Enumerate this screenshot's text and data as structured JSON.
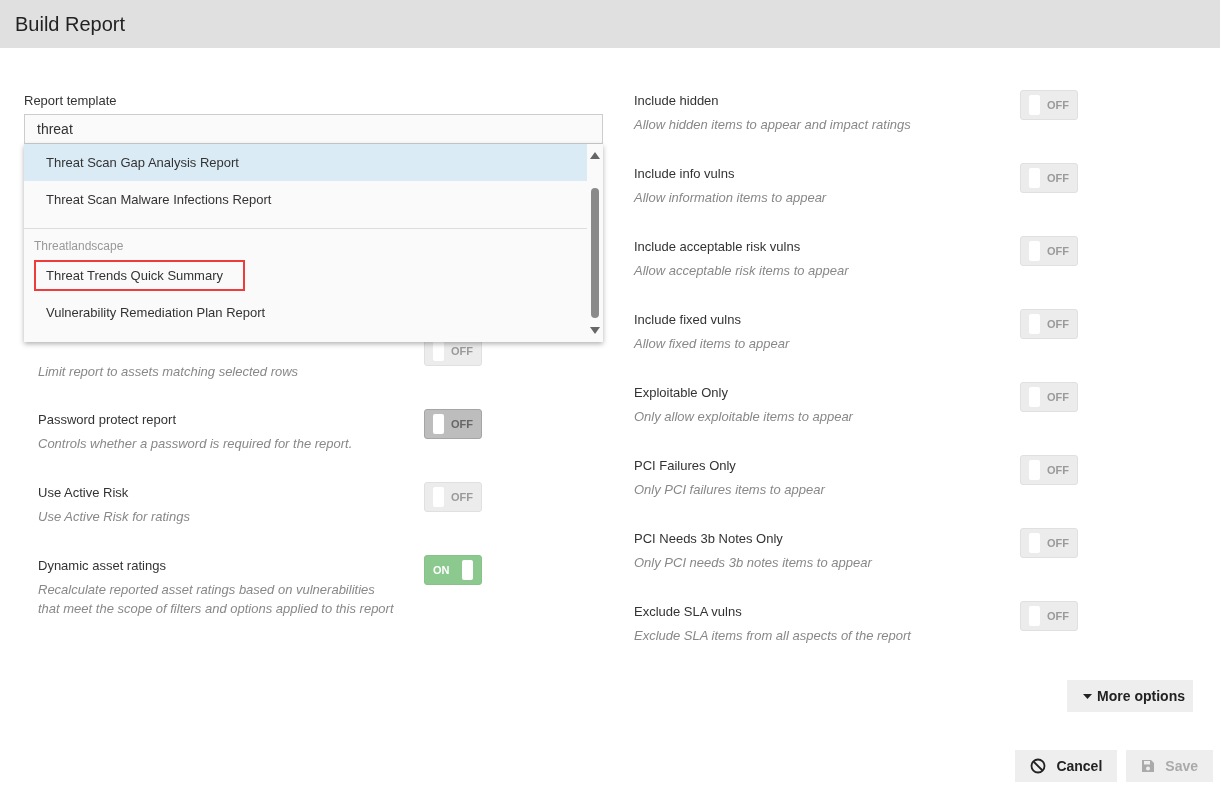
{
  "window": {
    "title": "Build Report"
  },
  "report_template": {
    "label": "Report template",
    "value": "threat",
    "dropdown": [
      {
        "kind": "option",
        "label": "Threat Scan Gap Analysis Report",
        "selected": true,
        "outlined": false
      },
      {
        "kind": "option",
        "label": "Threat Scan Malware Infections Report",
        "selected": false,
        "outlined": false
      },
      {
        "kind": "group",
        "label": "Threatlandscape"
      },
      {
        "kind": "option",
        "label": "Threat Trends Quick Summary",
        "selected": false,
        "outlined": true
      },
      {
        "kind": "option",
        "label": "Vulnerability Remediation Plan Report",
        "selected": false,
        "outlined": false
      }
    ]
  },
  "left_options": [
    {
      "description": "Limit report to assets matching selected rows",
      "on": false,
      "disabled": true,
      "state_text": "OFF"
    },
    {
      "label": "Password protect report",
      "description": "Controls whether a password is required for the report.",
      "on": false,
      "disabled": false,
      "state_text": "OFF"
    },
    {
      "label": "Use Active Risk",
      "description": "Use Active Risk for ratings",
      "on": false,
      "disabled": true,
      "state_text": "OFF"
    },
    {
      "label": "Dynamic asset ratings",
      "description": "Recalculate reported asset ratings based on vulnerabilities that meet the scope of filters and options applied to this report",
      "on": true,
      "disabled": true,
      "state_text": "ON"
    }
  ],
  "right_options": [
    {
      "label": "Include hidden",
      "description": "Allow hidden items to appear and impact ratings",
      "on": false,
      "disabled": true,
      "state_text": "OFF"
    },
    {
      "label": "Include info vulns",
      "description": "Allow information items to appear",
      "on": false,
      "disabled": true,
      "state_text": "OFF"
    },
    {
      "label": "Include acceptable risk vulns",
      "description": "Allow acceptable risk items to appear",
      "on": false,
      "disabled": true,
      "state_text": "OFF"
    },
    {
      "label": "Include fixed vulns",
      "description": "Allow fixed items to appear",
      "on": false,
      "disabled": true,
      "state_text": "OFF"
    },
    {
      "label": "Exploitable Only",
      "description": "Only allow exploitable items to appear",
      "on": false,
      "disabled": true,
      "state_text": "OFF"
    },
    {
      "label": "PCI Failures Only",
      "description": "Only PCI failures items to appear",
      "on": false,
      "disabled": true,
      "state_text": "OFF"
    },
    {
      "label": "PCI Needs 3b Notes Only",
      "description": "Only PCI needs 3b notes items to appear",
      "on": false,
      "disabled": true,
      "state_text": "OFF"
    },
    {
      "label": "Exclude SLA vulns",
      "description": "Exclude SLA items from all aspects of the report",
      "on": false,
      "disabled": true,
      "state_text": "OFF"
    }
  ],
  "more_options": {
    "label": "More options"
  },
  "buttons": [
    {
      "kind": "cancel",
      "label": "Cancel",
      "disabled": false
    },
    {
      "kind": "save",
      "label": "Save",
      "disabled": true
    }
  ]
}
